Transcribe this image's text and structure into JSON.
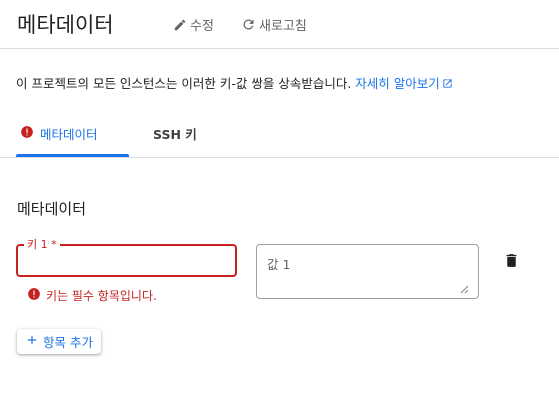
{
  "header": {
    "title": "메타데이터",
    "edit_label": "수정",
    "refresh_label": "새로고침"
  },
  "description": {
    "text": "이 프로젝트의 모든 인스턴스는 이러한 키-값 쌍을 상속받습니다. ",
    "link": "자세히 알아보기"
  },
  "tabs": [
    {
      "label": "메타데이터",
      "active": true,
      "has_error": true
    },
    {
      "label": "SSH 키",
      "active": false,
      "has_error": false
    }
  ],
  "section": {
    "title": "메타데이터"
  },
  "fields": {
    "key_label": "키 1 *",
    "key_value": "",
    "value_placeholder": "값 1",
    "error_text": "키는 필수 항목입니다."
  },
  "actions": {
    "add_label": "항목 추가"
  },
  "colors": {
    "accent": "#1a73e8",
    "error": "#c5221f",
    "text": "#202124",
    "muted": "#5f6368"
  },
  "icons": {
    "edit": "pencil-icon",
    "refresh": "refresh-icon",
    "external": "external-link-icon",
    "error": "error-icon",
    "trash": "trash-icon",
    "add": "plus-icon"
  }
}
